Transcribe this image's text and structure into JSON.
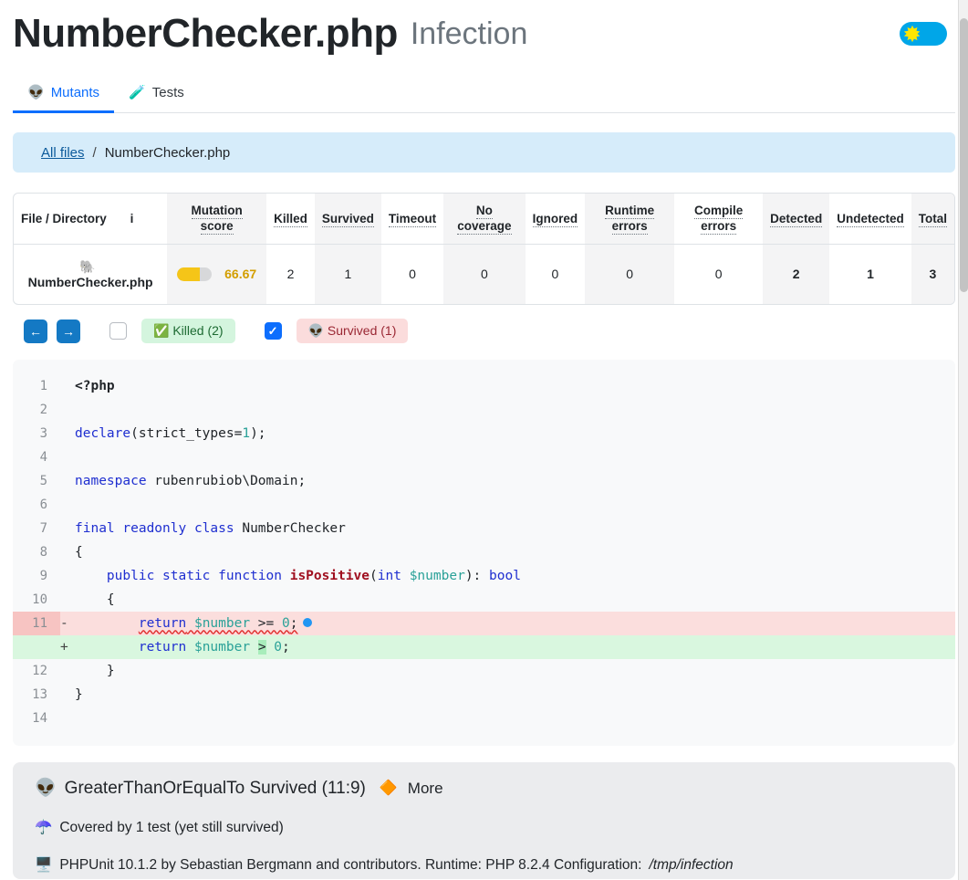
{
  "header": {
    "title": "NumberChecker.php",
    "subtitle": "Infection",
    "theme_toggle_icon": "sun-icon",
    "toggle_color": "#00a6e8"
  },
  "tabs": [
    {
      "icon": "alien-icon",
      "glyph": "👽",
      "label": "Mutants",
      "active": true
    },
    {
      "icon": "test-tube-icon",
      "glyph": "🧪",
      "label": "Tests",
      "active": false
    }
  ],
  "breadcrumb": {
    "root_label": "All files",
    "separator": "/",
    "current": "NumberChecker.php"
  },
  "table": {
    "columns": [
      "File / Directory",
      "Mutation score",
      "Killed",
      "Survived",
      "Timeout",
      "No coverage",
      "Ignored",
      "Runtime errors",
      "Compile errors",
      "Detected",
      "Undetected",
      "Total"
    ],
    "info_icon_label": "i",
    "row": {
      "file_icon": "elephant-icon",
      "file_glyph": "🐘",
      "file": "NumberChecker.php",
      "mutation_score": "66.67",
      "mutation_score_percent": 66.67,
      "killed": "2",
      "survived": "1",
      "timeout": "0",
      "no_coverage": "0",
      "ignored": "0",
      "runtime_errors": "0",
      "compile_errors": "0",
      "detected": "2",
      "undetected": "1",
      "total": "3"
    },
    "score_color": "#d39e00",
    "score_fill": "#f5c518"
  },
  "filters": {
    "prev_arrow": "←",
    "next_arrow": "→",
    "killed": {
      "label": "✅ Killed (2)",
      "checked": false,
      "bg": "#d4f5de",
      "fg": "#1d6a32"
    },
    "survived": {
      "label": "👽 Survived (1)",
      "checked": true,
      "bg": "#fbdcdc",
      "fg": "#9a2733"
    }
  },
  "code": {
    "lines": [
      {
        "n": "1",
        "type": "ctx"
      },
      {
        "n": "2",
        "type": "ctx"
      },
      {
        "n": "3",
        "type": "ctx"
      },
      {
        "n": "4",
        "type": "ctx"
      },
      {
        "n": "5",
        "type": "ctx"
      },
      {
        "n": "6",
        "type": "ctx"
      },
      {
        "n": "7",
        "type": "ctx"
      },
      {
        "n": "8",
        "type": "ctx"
      },
      {
        "n": "9",
        "type": "ctx"
      },
      {
        "n": "10",
        "type": "ctx"
      },
      {
        "n": "11",
        "type": "del",
        "sign": "-"
      },
      {
        "n": "",
        "type": "add",
        "sign": "+"
      },
      {
        "n": "12",
        "type": "ctx"
      },
      {
        "n": "13",
        "type": "ctx"
      },
      {
        "n": "14",
        "type": "ctx"
      }
    ],
    "text": {
      "l1": "<?php",
      "l3_kw": "declare",
      "l3_a": "(strict_types=",
      "l3_num": "1",
      "l3_b": ");",
      "l5_kw": "namespace",
      "l5_rest": " rubenrubiob\\Domain;",
      "l7_kw": "final readonly class",
      "l7_rest": " NumberChecker",
      "l8": "{",
      "l9_kw": "public static function",
      "l9_fn": "isPositive",
      "l9_p1": "(",
      "l9_t1": "int",
      "l9_var": " $number",
      "l9_p2": "): ",
      "l9_t2": "bool",
      "l10": "{",
      "l11_kw": "return",
      "l11_var": " $number",
      "l11_op": " >= ",
      "l11_num": "0",
      "l11_end": ";",
      "l12_kw": "return",
      "l12_var": " $number",
      "l12_op": ">",
      "l12_num": " 0",
      "l12_end": ";",
      "l13": "}",
      "l14": "}"
    }
  },
  "detail": {
    "mutant_icon": "alien-icon",
    "mutant_glyph": "👽",
    "title": "GreaterThanOrEqualTo Survived (11:9)",
    "more_icon": "warning-triangle-icon",
    "more_glyph": "🔶",
    "more_label": "More",
    "coverage_icon": "umbrella-icon",
    "coverage_glyph": "☂️",
    "coverage_text": "Covered by 1 test (yet still survived)",
    "runtime_icon": "computer-icon",
    "runtime_glyph": "🖥️",
    "runtime_text_a": "PHPUnit 10.1.2 by Sebastian Bergmann and contributors. Runtime: PHP 8.2.4 Configuration: ",
    "runtime_path": "/tmp/infection"
  }
}
